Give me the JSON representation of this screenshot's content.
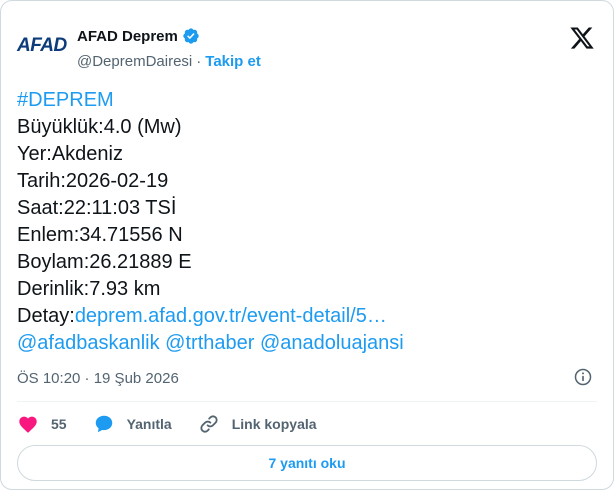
{
  "account": {
    "logo_text": "AFAD",
    "display_name": "AFAD Deprem",
    "handle": "@DepremDairesi",
    "separator": "·",
    "follow_label": "Takip et"
  },
  "tweet": {
    "hashtag": "#DEPREM",
    "lines": [
      "Büyüklük:4.0 (Mw)",
      "Yer:Akdeniz",
      "Tarih:2026-02-19",
      "Saat:22:11:03 TSİ",
      "Enlem:34.71556 N",
      "Boylam:26.21889 E",
      "Derinlik:7.93 km"
    ],
    "detail_label": "Detay:",
    "detail_link": "deprem.afad.gov.tr/event-detail/5…",
    "mentions": [
      "@afadbaskanlik",
      "@trthaber",
      "@anadoluajansi"
    ]
  },
  "meta": {
    "timestamp": "ÖS 10:20 · 19 Şub 2026"
  },
  "actions": {
    "likes_count": "55",
    "reply_label": "Yanıtla",
    "copy_link_label": "Link kopyala"
  },
  "read_replies_label": "7 yanıtı oku",
  "colors": {
    "accent": "#1d9bf0",
    "like": "#f91880",
    "text": "#0f1419",
    "muted": "#536471"
  },
  "icons": [
    "verified-badge-icon",
    "x-logo-icon",
    "info-icon",
    "heart-icon",
    "reply-bubble-icon",
    "link-icon"
  ]
}
